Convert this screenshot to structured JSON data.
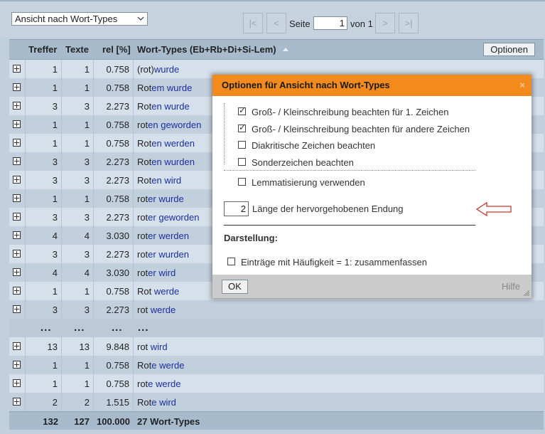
{
  "toolbar": {
    "view_select": "Ansicht nach Wort-Types",
    "first_label": "|<",
    "prev_label": "<",
    "page_label": "Seite",
    "page_value": "1",
    "of_label": "von 1",
    "next_label": ">",
    "last_label": ">|"
  },
  "table": {
    "columns": [
      "Treffer",
      "Texte",
      "rel [%]",
      "Wort-Types (Eb+Rb+Di+Si-Lem)"
    ],
    "options_label": "Optionen",
    "rows": [
      {
        "treffer": "1",
        "texte": "1",
        "rel": "0.758",
        "pre": "(rot)",
        "post": "wurde"
      },
      {
        "treffer": "1",
        "texte": "1",
        "rel": "0.758",
        "pre": "Rot",
        "post": "em wurde"
      },
      {
        "treffer": "3",
        "texte": "3",
        "rel": "2.273",
        "pre": "Rot",
        "post": "en wurde"
      },
      {
        "treffer": "1",
        "texte": "1",
        "rel": "0.758",
        "pre": "rot",
        "post": "en geworden"
      },
      {
        "treffer": "1",
        "texte": "1",
        "rel": "0.758",
        "pre": "Rot",
        "post": "en werden"
      },
      {
        "treffer": "3",
        "texte": "3",
        "rel": "2.273",
        "pre": "Rot",
        "post": "en wurden"
      },
      {
        "treffer": "3",
        "texte": "3",
        "rel": "2.273",
        "pre": "Rot",
        "post": "en wird"
      },
      {
        "treffer": "1",
        "texte": "1",
        "rel": "0.758",
        "pre": "rot",
        "post": "er wurde"
      },
      {
        "treffer": "3",
        "texte": "3",
        "rel": "2.273",
        "pre": "rot",
        "post": "er geworden"
      },
      {
        "treffer": "4",
        "texte": "4",
        "rel": "3.030",
        "pre": "rot",
        "post": "er werden"
      },
      {
        "treffer": "3",
        "texte": "3",
        "rel": "2.273",
        "pre": "rot",
        "post": "er wurden"
      },
      {
        "treffer": "4",
        "texte": "4",
        "rel": "3.030",
        "pre": "rot",
        "post": "er wird"
      },
      {
        "treffer": "1",
        "texte": "1",
        "rel": "0.758",
        "pre": "Rot",
        "post": " werde"
      },
      {
        "treffer": "3",
        "texte": "3",
        "rel": "2.273",
        "pre": "rot",
        "post": " werde"
      }
    ],
    "ellipsis": "...",
    "rows_after": [
      {
        "treffer": "13",
        "texte": "13",
        "rel": "9.848",
        "pre": "rot",
        "post": " wird"
      },
      {
        "treffer": "1",
        "texte": "1",
        "rel": "0.758",
        "pre": "Rot",
        "post": "e werde"
      },
      {
        "treffer": "1",
        "texte": "1",
        "rel": "0.758",
        "pre": "rot",
        "post": "e werde"
      },
      {
        "treffer": "2",
        "texte": "2",
        "rel": "1.515",
        "pre": "Rot",
        "post": "e wird"
      }
    ],
    "totals": {
      "treffer": "132",
      "texte": "127",
      "rel": "100.000",
      "label": "27 Wort-Types"
    }
  },
  "dialog": {
    "title": "Optionen für Ansicht nach Wort-Types",
    "close": "×",
    "options": [
      {
        "label": "Groß- / Kleinschreibung beachten für 1. Zeichen",
        "checked": true
      },
      {
        "label": "Groß- / Kleinschreibung beachten für andere Zeichen",
        "checked": true
      },
      {
        "label": "Diakritische Zeichen beachten",
        "checked": false
      },
      {
        "label": "Sonderzeichen beachten",
        "checked": false
      },
      {
        "label": "Lemmatisierung verwenden",
        "checked": false
      }
    ],
    "ending_length_value": "2",
    "ending_length_label": "Länge der hervorgehobenen Endung",
    "section_label": "Darstellung:",
    "merge_label": "Einträge mit Häufigkeit = 1: zusammenfassen",
    "merge_checked": false,
    "ok_label": "OK",
    "help_label": "Hilfe"
  },
  "colors": {
    "dialog_title_bg": "#f28b1b",
    "link_blue": "#1a2f9c",
    "annotation_arrow": "#c0392b"
  }
}
